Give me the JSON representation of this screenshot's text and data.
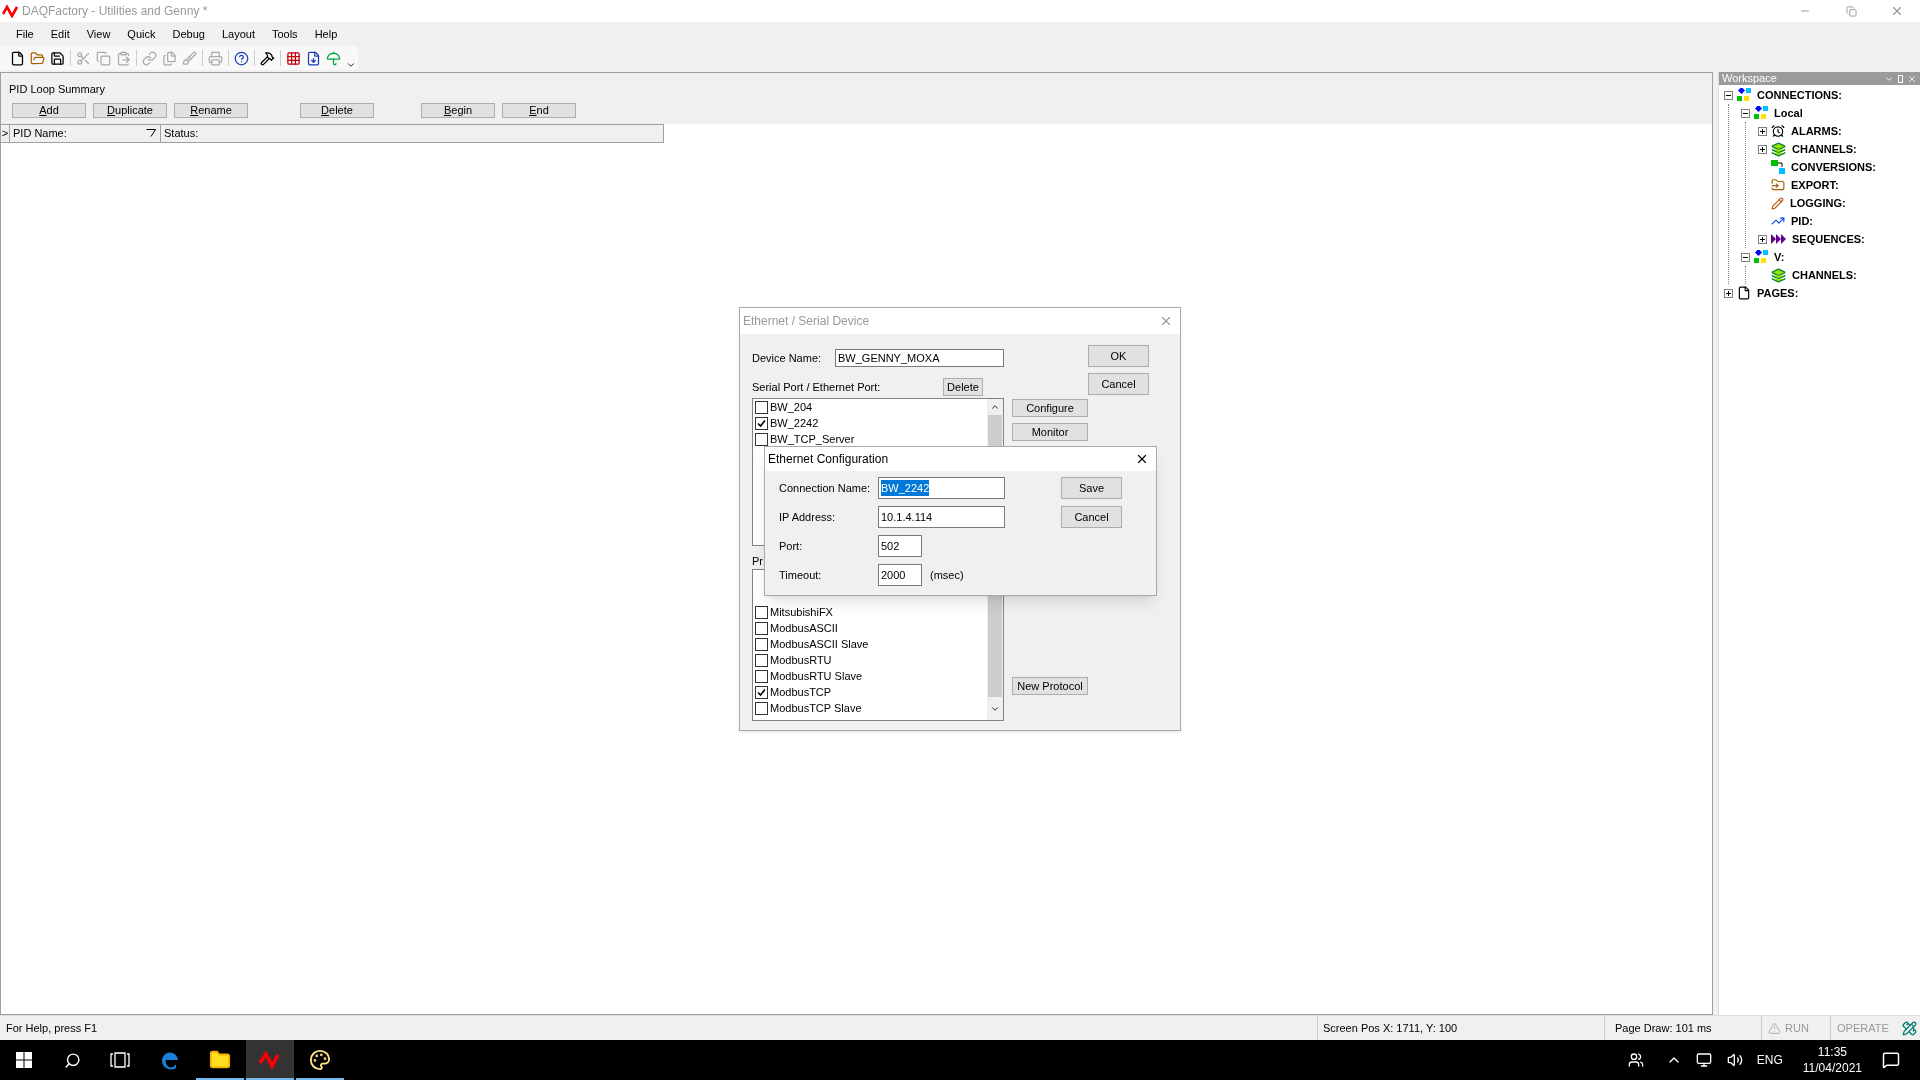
{
  "window": {
    "title": "DAQFactory - Utilities and Genny *"
  },
  "menu": [
    "File",
    "Edit",
    "View",
    "Quick",
    "Debug",
    "Layout",
    "Tools",
    "Help"
  ],
  "toolbar": [
    {
      "kind": "new",
      "disabled": false
    },
    {
      "kind": "open",
      "disabled": false
    },
    {
      "kind": "save",
      "disabled": false
    },
    {
      "kind": "cut",
      "disabled": true
    },
    {
      "kind": "copy",
      "disabled": true
    },
    {
      "kind": "paste",
      "disabled": true
    },
    {
      "kind": "link",
      "disabled": true
    },
    {
      "kind": "duplicate",
      "disabled": true
    },
    {
      "kind": "brush",
      "disabled": true
    },
    {
      "kind": "print",
      "disabled": true
    },
    {
      "kind": "help",
      "disabled": false
    },
    {
      "kind": "tools",
      "disabled": false
    },
    {
      "kind": "grid",
      "disabled": false
    },
    {
      "kind": "import",
      "disabled": false
    },
    {
      "kind": "umbrella",
      "disabled": false
    }
  ],
  "pid_summary": {
    "title": "PID Loop Summary",
    "buttons": [
      "Add",
      "Duplicate",
      "Rename",
      "Delete",
      "Begin",
      "End"
    ],
    "columns": [
      ">",
      "PID Name:",
      "Status:"
    ]
  },
  "device_dialog": {
    "title": "Ethernet / Serial Device",
    "device_name_label": "Device Name:",
    "device_name": "BW_GENNY_MOXA",
    "port_label": "Serial Port / Ethernet Port:",
    "delete_button": "Delete",
    "ports": [
      {
        "label": "BW_204",
        "checked": false
      },
      {
        "label": "BW_2242",
        "checked": true
      },
      {
        "label": "BW_TCP_Server",
        "checked": false
      }
    ],
    "protocol_label": "Pr",
    "protocols": [
      {
        "label": "MitsubishiFX",
        "checked": false
      },
      {
        "label": "ModbusASCII",
        "checked": false
      },
      {
        "label": "ModbusASCII Slave",
        "checked": false
      },
      {
        "label": "ModbusRTU",
        "checked": false
      },
      {
        "label": "ModbusRTU Slave",
        "checked": false
      },
      {
        "label": "ModbusTCP",
        "checked": true
      },
      {
        "label": "ModbusTCP Slave",
        "checked": false
      }
    ],
    "side_buttons": [
      "Configure",
      "Monitor"
    ],
    "new_protocol_button": "New Protocol",
    "ok_button": "OK",
    "cancel_button": "Cancel"
  },
  "ethernet_dialog": {
    "title": "Ethernet Configuration",
    "fields": [
      {
        "label": "Connection Name:",
        "value": "BW_2242",
        "text_selected": true,
        "kind": "wide"
      },
      {
        "label": "IP Address:",
        "value": "10.1.4.114",
        "text_selected": false,
        "kind": "wide"
      },
      {
        "label": "Port:",
        "value": "502",
        "text_selected": false,
        "kind": "narrow"
      },
      {
        "label": "Timeout:",
        "value": "2000",
        "text_selected": false,
        "kind": "narrow",
        "unit": "(msec)"
      }
    ],
    "save_button": "Save",
    "cancel_button": "Cancel"
  },
  "workspace": {
    "title": "Workspace",
    "tree": [
      {
        "label": "CONNECTIONS:",
        "kind": "connection",
        "expanded": true,
        "children": [
          {
            "label": "Local",
            "kind": "connection",
            "expanded": true,
            "children": [
              {
                "label": "ALARMS:",
                "kind": "alarms",
                "expanded": false
              },
              {
                "label": "CHANNELS:",
                "kind": "channels",
                "expanded": false
              },
              {
                "label": "CONVERSIONS:",
                "kind": "conversions"
              },
              {
                "label": "EXPORT:",
                "kind": "export"
              },
              {
                "label": "LOGGING:",
                "kind": "logging"
              },
              {
                "label": "PID:",
                "kind": "pid"
              },
              {
                "label": "SEQUENCES:",
                "kind": "sequences",
                "expanded": false
              }
            ]
          },
          {
            "label": "V:",
            "kind": "connection",
            "expanded": true,
            "children": [
              {
                "label": "CHANNELS:",
                "kind": "channels"
              }
            ]
          }
        ]
      },
      {
        "label": "PAGES:",
        "kind": "pages",
        "expanded": false
      }
    ]
  },
  "status_bar": {
    "help": "For Help, press F1",
    "screen_pos": "Screen Pos X: 1711, Y: 100",
    "page_draw": "Page Draw: 101 ms",
    "modes": [
      {
        "label": "RUN",
        "disabled": true
      },
      {
        "label": "OPERATE",
        "disabled": true
      }
    ]
  },
  "taskbar": {
    "apps": [
      {
        "kind": "edge",
        "running": false,
        "selected": false
      },
      {
        "kind": "explorer",
        "running": true,
        "selected": false
      },
      {
        "kind": "daqfactory",
        "running": true,
        "selected": true
      },
      {
        "kind": "paint",
        "running": true,
        "selected": false
      }
    ],
    "language": "ENG",
    "time": "11:35",
    "date": "11/04/2021"
  }
}
